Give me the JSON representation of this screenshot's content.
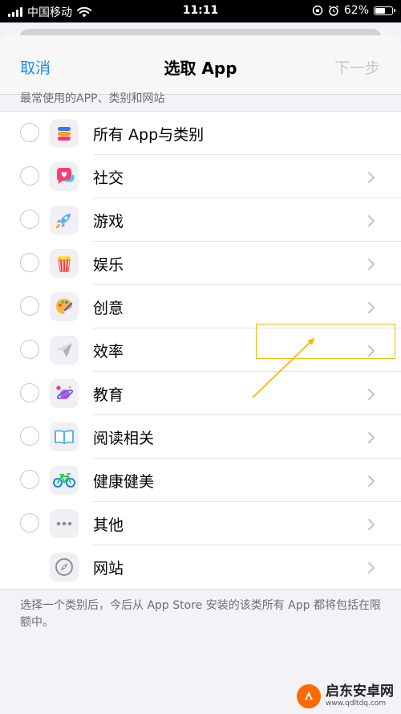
{
  "status_bar": {
    "carrier": "中国移动",
    "time": "11:11",
    "battery": "62%",
    "battery_level": 0.62
  },
  "nav": {
    "cancel": "取消",
    "title": "选取 App",
    "next": "下一步"
  },
  "section_header": "最常使用的APP、类别和网站",
  "rows": [
    {
      "label": "所有 App与类别",
      "icon": "stack-icon",
      "radio": true,
      "chevron": false
    },
    {
      "label": "社交",
      "icon": "chat-heart-icon",
      "radio": true,
      "chevron": true
    },
    {
      "label": "游戏",
      "icon": "rocket-icon",
      "radio": true,
      "chevron": true
    },
    {
      "label": "娱乐",
      "icon": "popcorn-icon",
      "radio": true,
      "chevron": true
    },
    {
      "label": "创意",
      "icon": "palette-icon",
      "radio": true,
      "chevron": true
    },
    {
      "label": "效率",
      "icon": "paper-plane-icon",
      "radio": true,
      "chevron": true
    },
    {
      "label": "教育",
      "icon": "planet-icon",
      "radio": true,
      "chevron": true
    },
    {
      "label": "阅读相关",
      "icon": "book-icon",
      "radio": true,
      "chevron": true
    },
    {
      "label": "健康健美",
      "icon": "bicycle-icon",
      "radio": true,
      "chevron": true
    },
    {
      "label": "其他",
      "icon": "ellipsis-icon",
      "radio": true,
      "chevron": true
    },
    {
      "label": "网站",
      "icon": "compass-icon",
      "radio": false,
      "chevron": true
    }
  ],
  "footer_note": "选择一个类别后，今后从 App Store 安装的该类所有 App 都将包括在限额中。",
  "watermark": {
    "name": "启东安卓网",
    "url": "www.qdltdq.com"
  },
  "colors": {
    "accent": "#1a8cff",
    "disabled": "#c7c7cc",
    "annotation": "#f5b800"
  }
}
